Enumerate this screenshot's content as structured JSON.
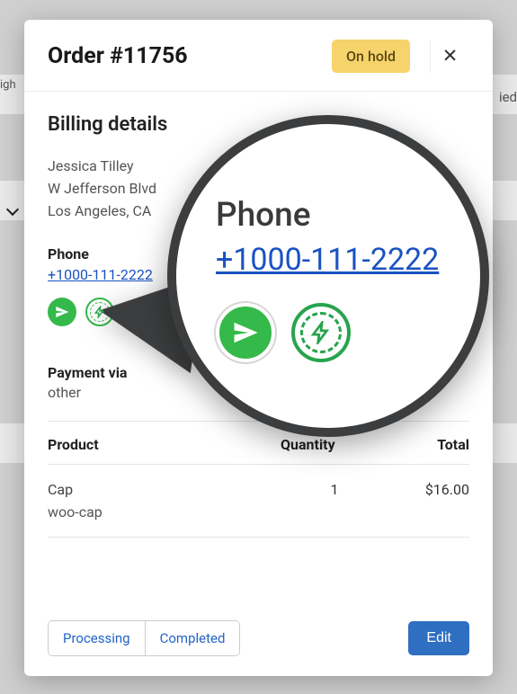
{
  "background": {
    "left_fragment": "igh",
    "right_fragment": "ied"
  },
  "header": {
    "title": "Order #11756",
    "status_label": "On hold"
  },
  "billing": {
    "heading": "Billing details",
    "customer": {
      "name": "Jessica Tilley",
      "street": "W Jefferson Blvd",
      "city_state": "Los Angeles, CA"
    },
    "phone_label": "Phone",
    "phone_value": "+1000-111-2222",
    "payment_label": "Payment via",
    "payment_value": "other",
    "action_icons": [
      "send-icon",
      "bolt-icon"
    ]
  },
  "table": {
    "headers": {
      "product": "Product",
      "quantity": "Quantity",
      "total": "Total"
    },
    "rows": [
      {
        "product": "Cap",
        "sku": "woo-cap",
        "quantity": "1",
        "total": "$16.00"
      }
    ]
  },
  "footer": {
    "processing_label": "Processing",
    "completed_label": "Completed",
    "edit_label": "Edit"
  },
  "magnifier": {
    "phone_label": "Phone",
    "phone_value": "+1000-111-2222"
  }
}
